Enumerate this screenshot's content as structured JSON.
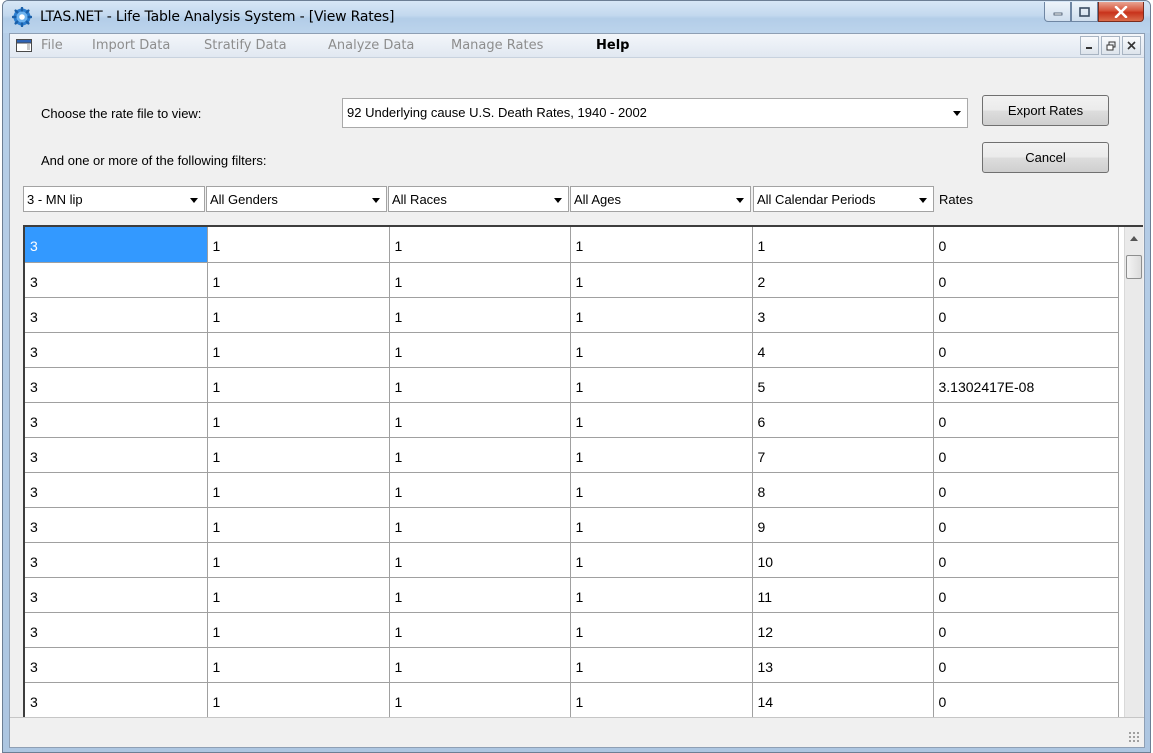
{
  "window": {
    "title": "LTAS.NET - Life Table Analysis System - [View Rates]"
  },
  "menu": {
    "items": [
      {
        "label": "File",
        "enabled": false
      },
      {
        "label": "Import Data",
        "enabled": false
      },
      {
        "label": "Stratify Data",
        "enabled": false
      },
      {
        "label": "Analyze Data",
        "enabled": false
      },
      {
        "label": "Manage Rates",
        "enabled": false
      },
      {
        "label": "Help",
        "enabled": true
      }
    ]
  },
  "form": {
    "rate_file_label": "Choose the rate file to view:",
    "rate_file_value": "92 Underlying cause U.S. Death Rates, 1940 - 2002",
    "filters_label": "And one or more of the following filters:",
    "export_button": "Export Rates",
    "cancel_button": "Cancel"
  },
  "filters": {
    "cause": "3 - MN lip",
    "gender": "All Genders",
    "race": "All Races",
    "age": "All Ages",
    "period": "All Calendar Periods",
    "rates_label": "Rates"
  },
  "grid": {
    "rows": [
      [
        "3",
        "1",
        "1",
        "1",
        "1",
        "0"
      ],
      [
        "3",
        "1",
        "1",
        "1",
        "2",
        "0"
      ],
      [
        "3",
        "1",
        "1",
        "1",
        "3",
        "0"
      ],
      [
        "3",
        "1",
        "1",
        "1",
        "4",
        "0"
      ],
      [
        "3",
        "1",
        "1",
        "1",
        "5",
        "3.1302417E-08"
      ],
      [
        "3",
        "1",
        "1",
        "1",
        "6",
        "0"
      ],
      [
        "3",
        "1",
        "1",
        "1",
        "7",
        "0"
      ],
      [
        "3",
        "1",
        "1",
        "1",
        "8",
        "0"
      ],
      [
        "3",
        "1",
        "1",
        "1",
        "9",
        "0"
      ],
      [
        "3",
        "1",
        "1",
        "1",
        "10",
        "0"
      ],
      [
        "3",
        "1",
        "1",
        "1",
        "11",
        "0"
      ],
      [
        "3",
        "1",
        "1",
        "1",
        "12",
        "0"
      ],
      [
        "3",
        "1",
        "1",
        "1",
        "13",
        "0"
      ],
      [
        "3",
        "1",
        "1",
        "1",
        "14",
        "0"
      ]
    ]
  },
  "icons": {
    "app": "gear-icon",
    "mdi": "mdi-child-window-icon"
  },
  "colors": {
    "selection": "#3399ff",
    "close_button": "#c8321b"
  }
}
